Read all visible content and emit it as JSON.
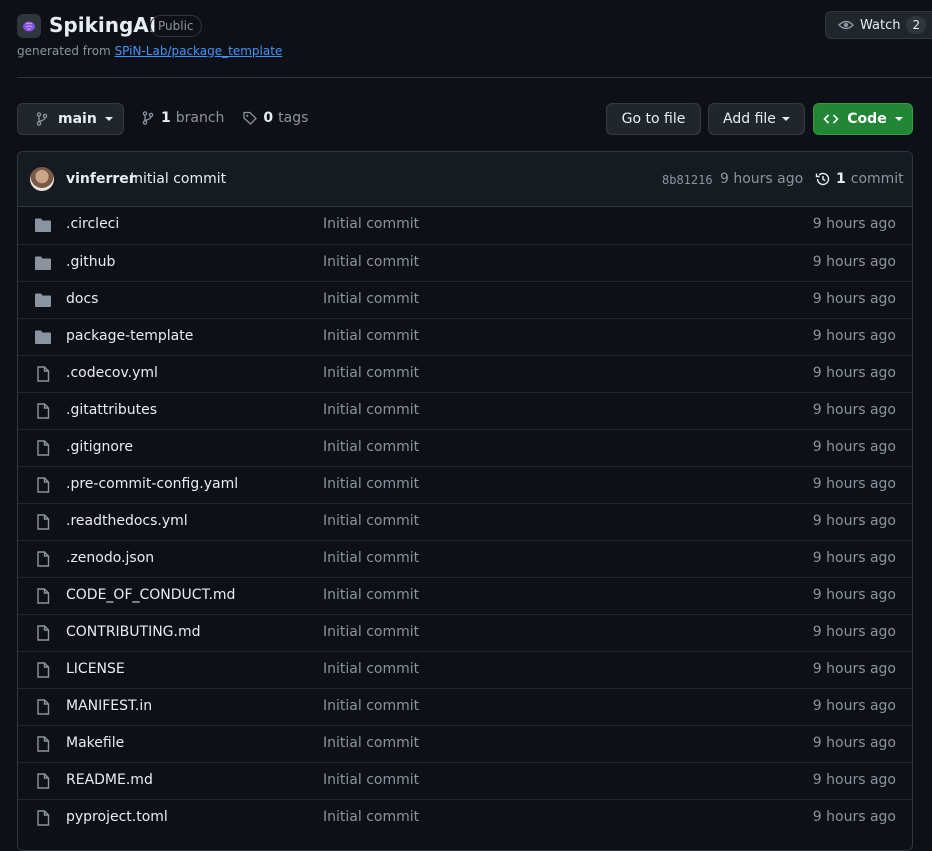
{
  "repo": {
    "name": "SpikingAI",
    "visibility": "Public",
    "generated_prefix": "generated from",
    "template_link": "SPiN-Lab/package_template",
    "watch_label": "Watch",
    "watch_count": "2"
  },
  "toolbar": {
    "branch": "main",
    "branch_count": "1",
    "branch_label": "branch",
    "tag_count": "0",
    "tag_label": "tags",
    "goto_file": "Go to file",
    "add_file": "Add file",
    "code": "Code"
  },
  "latest_commit": {
    "author": "vinferrer",
    "message": "Initial commit",
    "sha": "8b81216",
    "time": "9 hours ago",
    "commit_count": "1",
    "commit_label": "commit"
  },
  "files": [
    {
      "type": "folder",
      "name": ".circleci",
      "message": "Initial commit",
      "time": "9 hours ago"
    },
    {
      "type": "folder",
      "name": ".github",
      "message": "Initial commit",
      "time": "9 hours ago"
    },
    {
      "type": "folder",
      "name": "docs",
      "message": "Initial commit",
      "time": "9 hours ago"
    },
    {
      "type": "folder",
      "name": "package-template",
      "message": "Initial commit",
      "time": "9 hours ago"
    },
    {
      "type": "file",
      "name": ".codecov.yml",
      "message": "Initial commit",
      "time": "9 hours ago"
    },
    {
      "type": "file",
      "name": ".gitattributes",
      "message": "Initial commit",
      "time": "9 hours ago"
    },
    {
      "type": "file",
      "name": ".gitignore",
      "message": "Initial commit",
      "time": "9 hours ago"
    },
    {
      "type": "file",
      "name": ".pre-commit-config.yaml",
      "message": "Initial commit",
      "time": "9 hours ago"
    },
    {
      "type": "file",
      "name": ".readthedocs.yml",
      "message": "Initial commit",
      "time": "9 hours ago"
    },
    {
      "type": "file",
      "name": ".zenodo.json",
      "message": "Initial commit",
      "time": "9 hours ago"
    },
    {
      "type": "file",
      "name": "CODE_OF_CONDUCT.md",
      "message": "Initial commit",
      "time": "9 hours ago"
    },
    {
      "type": "file",
      "name": "CONTRIBUTING.md",
      "message": "Initial commit",
      "time": "9 hours ago"
    },
    {
      "type": "file",
      "name": "LICENSE",
      "message": "Initial commit",
      "time": "9 hours ago"
    },
    {
      "type": "file",
      "name": "MANIFEST.in",
      "message": "Initial commit",
      "time": "9 hours ago"
    },
    {
      "type": "file",
      "name": "Makefile",
      "message": "Initial commit",
      "time": "9 hours ago"
    },
    {
      "type": "file",
      "name": "README.md",
      "message": "Initial commit",
      "time": "9 hours ago"
    },
    {
      "type": "file",
      "name": "pyproject.toml",
      "message": "Initial commit",
      "time": "9 hours ago"
    }
  ],
  "colors": {
    "background": "#0d1117",
    "accent_green": "#238636",
    "link_blue": "#4493f8",
    "muted_text": "#8b949e"
  }
}
